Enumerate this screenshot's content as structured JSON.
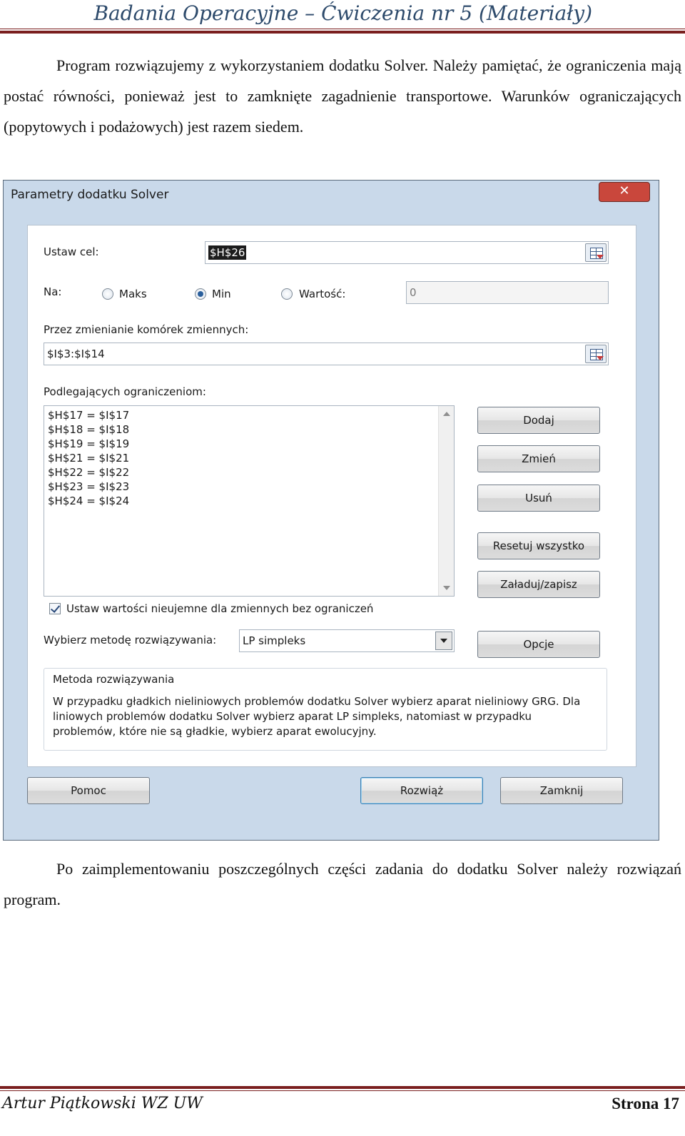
{
  "header": {
    "title": "Badania Operacyjne – Ćwiczenia nr 5 (Materiały)"
  },
  "intro": {
    "text": "Program rozwiązujemy z wykorzystaniem dodatku Solver. Należy pamiętać, że ograniczenia mają postać równości, ponieważ jest to zamknięte zagadnienie transportowe. Warunków ograniczających (popytowych i podażowych) jest razem siedem."
  },
  "dialog": {
    "title": "Parametry dodatku Solver",
    "close_label": "✕",
    "set_objective_label": "Ustaw cel:",
    "set_objective_value": "$H$26",
    "to_label": "Na:",
    "options": {
      "max": "Maks",
      "min": "Min",
      "value_of": "Wartość:"
    },
    "selected_option": "Min",
    "value_of_field": "0",
    "changing_cells_label": "Przez zmienianie komórek zmiennych:",
    "changing_cells_value": "$I$3:$I$14",
    "constraints_label": "Podlegających ograniczeniom:",
    "constraints": [
      "$H$17 = $I$17",
      "$H$18 = $I$18",
      "$H$19 = $I$19",
      "$H$21 = $I$21",
      "$H$22 = $I$22",
      "$H$23 = $I$23",
      "$H$24 = $I$24"
    ],
    "buttons": {
      "add": "Dodaj",
      "change": "Zmień",
      "delete": "Usuń",
      "reset_all": "Resetuj wszystko",
      "load_save": "Załaduj/zapisz",
      "options": "Opcje",
      "help": "Pomoc",
      "solve": "Rozwiąż",
      "close": "Zamknij"
    },
    "nonnegative_label": "Ustaw wartości nieujemne dla zmiennych bez ograniczeń",
    "nonnegative_checked": true,
    "method_label": "Wybierz metodę rozwiązywania:",
    "method_value": "LP simpleks",
    "method_group_title": "Metoda rozwiązywania",
    "method_description": "W przypadku gładkich nieliniowych problemów dodatku Solver wybierz aparat nieliniowy GRG. Dla liniowych problemów dodatku Solver wybierz aparat LP simpleks, natomiast w przypadku problemów, które nie są gładkie, wybierz aparat ewolucyjny."
  },
  "after": {
    "text": "Po zaimplementowaniu poszczególnych części zadania do dodatku Solver należy rozwiązań program."
  },
  "footer": {
    "author": "Artur Piątkowski WZ UW",
    "page": "Strona 17"
  }
}
